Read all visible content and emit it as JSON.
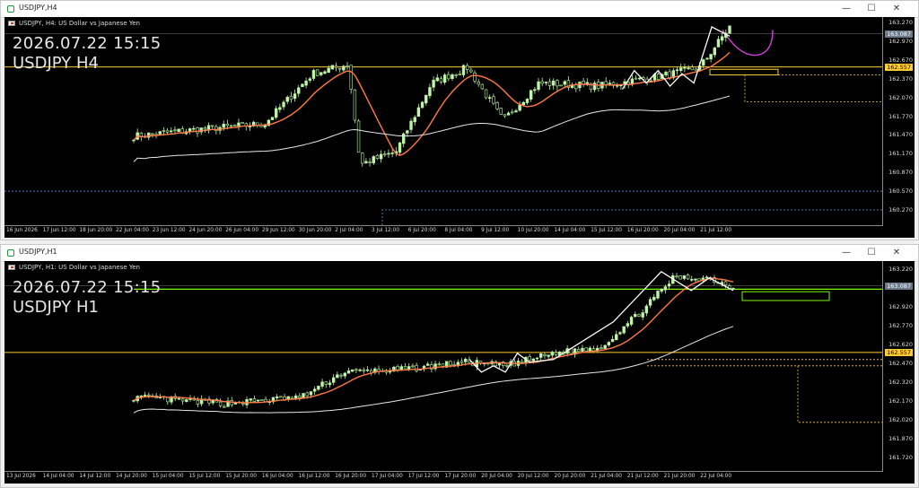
{
  "windows": [
    {
      "id": "h4",
      "title": "USDJPY,H4",
      "controls": {
        "minimize": "—",
        "maximize": "☐",
        "close": "✕"
      },
      "symbol_desc": "USDJPY, H4:  US Dollar vs Japanese Yen",
      "overlay_time": "2026.07.22 15:15",
      "overlay_symbol": "USDJPY H4",
      "y_ticks": [
        "163.270",
        "162.970",
        "162.670",
        "162.370",
        "162.070",
        "161.770",
        "161.470",
        "161.170",
        "160.870",
        "160.570",
        "160.270"
      ],
      "y_tag_price": "163.087",
      "y_tag_level": "162.557",
      "x_ticks": [
        "16 Jun 2026",
        "17 Jun 12:00",
        "18 Jun 20:00",
        "22 Jun 04:00",
        "23 Jun 12:00",
        "24 Jun 20:00",
        "26 Jun 04:00",
        "29 Jun 12:00",
        "30 Jun 20:00",
        "2 Jul 04:00",
        "3 Jul 12:00",
        "6 Jul 20:00",
        "8 Jul 04:00",
        "9 Jul 12:00",
        "10 Jul 20:00",
        "14 Jul 04:00",
        "15 Jul 12:00",
        "16 Jul 20:00",
        "20 Jul 04:00",
        "21 Jul 12:00"
      ],
      "chart_data": {
        "type": "candlestick",
        "ylim": [
          160.2,
          163.3
        ],
        "current_price": 163.087,
        "level": 162.557,
        "candles": 160
      }
    },
    {
      "id": "h1",
      "title": "USDJPY,H1",
      "controls": {
        "minimize": "—",
        "maximize": "☐",
        "close": "✕"
      },
      "symbol_desc": "USDJPY, H1:  US Dollar vs Japanese Yen",
      "overlay_time": "2026.07.22 15:15",
      "overlay_symbol": "USDJPY H1",
      "y_ticks": [
        "163.220",
        "163.070",
        "162.920",
        "162.770",
        "162.620",
        "162.470",
        "162.320",
        "162.170",
        "162.020",
        "161.870",
        "161.720"
      ],
      "y_tag_price": "163.087",
      "y_tag_level": "162.557",
      "x_ticks": [
        "13 Jul 2026",
        "14 Jul 04:00",
        "14 Jul 12:00",
        "14 Jul 20:00",
        "15 Jul 04:00",
        "15 Jul 12:00",
        "15 Jul 20:00",
        "16 Jul 04:00",
        "16 Jul 12:00",
        "16 Jul 20:00",
        "17 Jul 04:00",
        "17 Jul 12:00",
        "17 Jul 20:00",
        "20 Jul 04:00",
        "20 Jul 12:00",
        "20 Jul 20:00",
        "21 Jul 04:00",
        "21 Jul 12:00",
        "21 Jul 20:00",
        "22 Jul 04:00"
      ],
      "chart_data": {
        "type": "candlestick",
        "ylim": [
          161.7,
          163.25
        ],
        "current_price": 163.087,
        "level": 162.557,
        "candles": 160
      }
    }
  ],
  "colors": {
    "bull": "#bff5a8",
    "bear": "#bff5a8",
    "ma_fast": "#ff7a45",
    "ma_slow": "#e8e8e8",
    "level": "#ffcc33",
    "green_level": "#7CFC00",
    "zigzag": "#ffffff",
    "sketch": "#d23fd6"
  }
}
